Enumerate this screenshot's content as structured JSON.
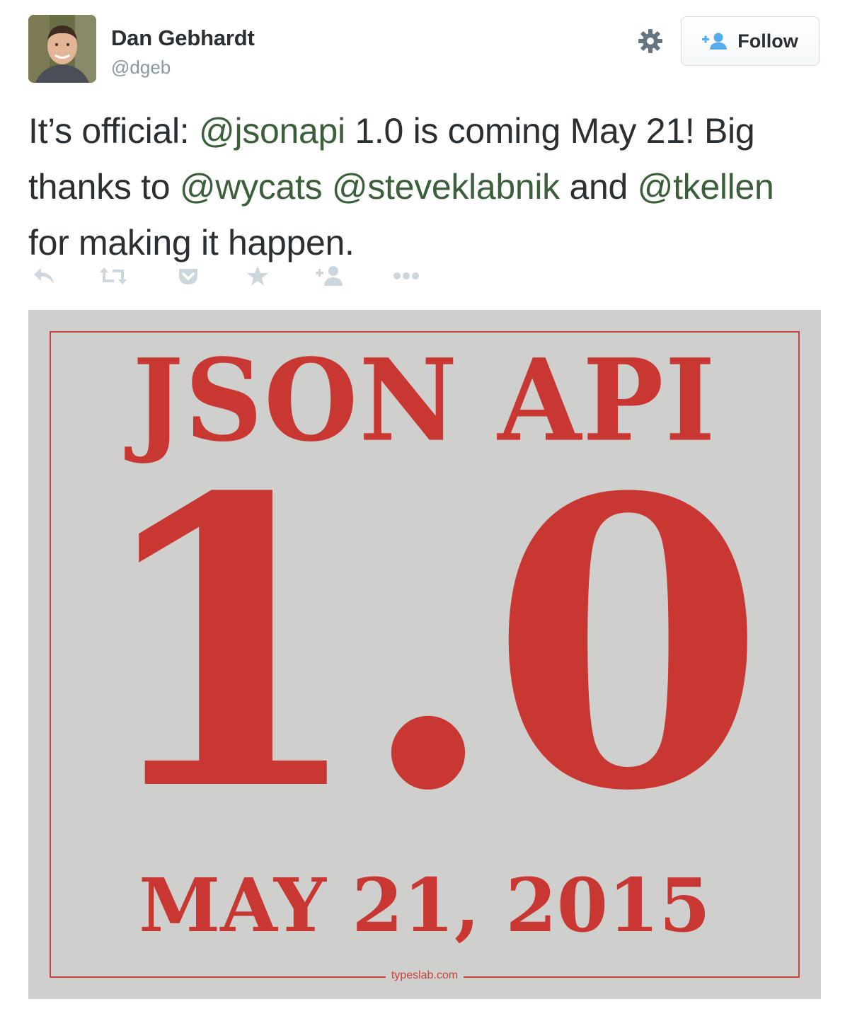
{
  "author": {
    "name": "Dan Gebhardt",
    "handle": "@dgeb"
  },
  "follow_button": {
    "label": "Follow",
    "icon": "add-user-icon"
  },
  "settings_icon": "gear-icon",
  "tweet": {
    "segments": [
      {
        "text": "It’s official: ",
        "mention": false
      },
      {
        "text": "@jsonapi",
        "mention": true
      },
      {
        "text": " 1.0 is coming May 21! Big thanks to ",
        "mention": false
      },
      {
        "text": "@wycats",
        "mention": true
      },
      {
        "text": " ",
        "mention": false
      },
      {
        "text": "@steveklabnik",
        "mention": true
      },
      {
        "text": " and ",
        "mention": false
      },
      {
        "text": "@tkellen",
        "mention": true
      },
      {
        "text": " for making it happen.",
        "mention": false
      }
    ]
  },
  "actions": [
    {
      "name": "reply-icon"
    },
    {
      "name": "retweet-icon"
    },
    {
      "name": "pocket-icon"
    },
    {
      "name": "favorite-icon"
    },
    {
      "name": "add-user-icon"
    },
    {
      "name": "more-icon"
    }
  ],
  "media": {
    "line1": "JSON API",
    "line2": "1.0",
    "line3": "MAY 21, 2015",
    "credit": "typeslab.com"
  },
  "colors": {
    "mention": "#3b5e3b",
    "poster_red": "#c93733",
    "poster_bg": "#cfd0ce",
    "icon_gray": "#ccd6dd"
  }
}
